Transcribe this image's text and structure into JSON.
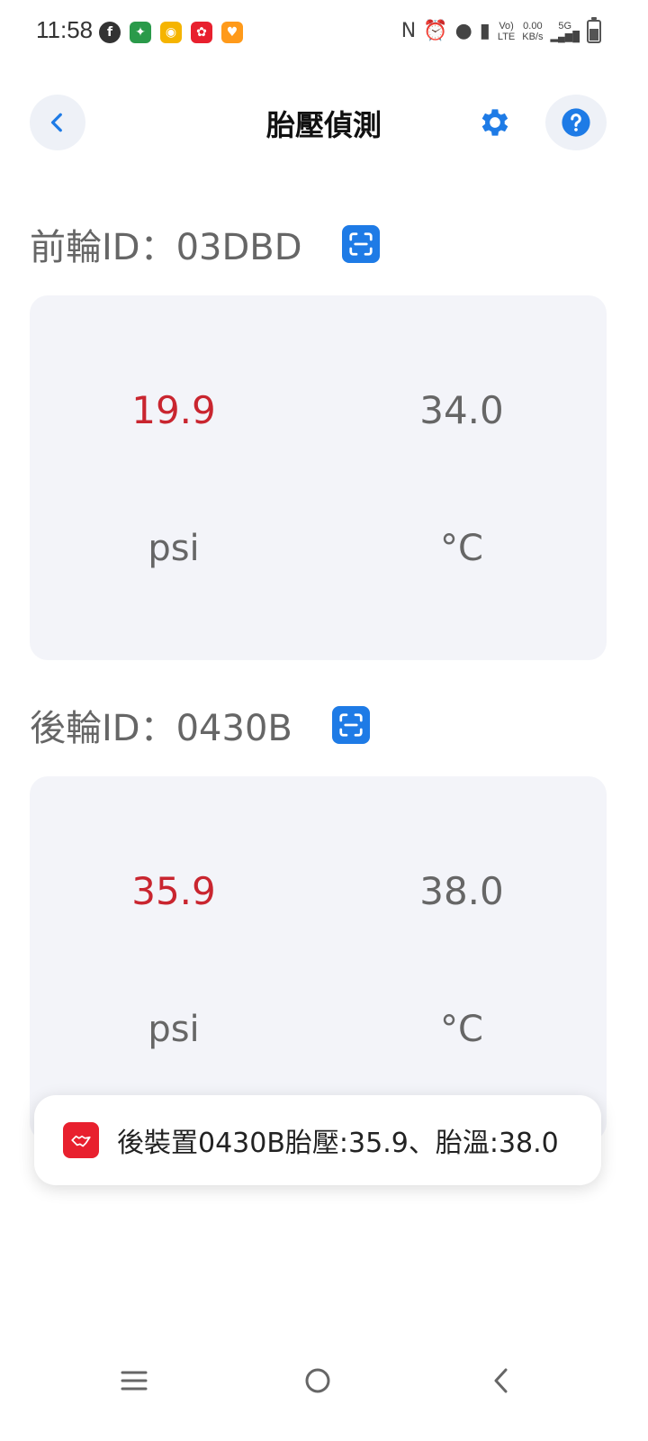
{
  "status_bar": {
    "time": "11:58",
    "net_top": "0.00",
    "net_bottom": "KB/s",
    "lte": "LTE",
    "five_g": "5G"
  },
  "header": {
    "title": "胎壓偵測"
  },
  "front": {
    "label": "前輪ID：03DBD",
    "pressure": "19.9",
    "temperature": "34.0",
    "pressure_unit": "psi",
    "temperature_unit": "°C"
  },
  "rear": {
    "label": "後輪ID：0430B",
    "pressure": "35.9",
    "temperature": "38.0",
    "pressure_unit": "psi",
    "temperature_unit": "°C"
  },
  "toast": {
    "message": "後裝置0430B胎壓:35.9、胎溫:38.0"
  },
  "colors": {
    "accent": "#1e7be6",
    "warning": "#c9252f",
    "card_bg": "#f3f4f9"
  }
}
